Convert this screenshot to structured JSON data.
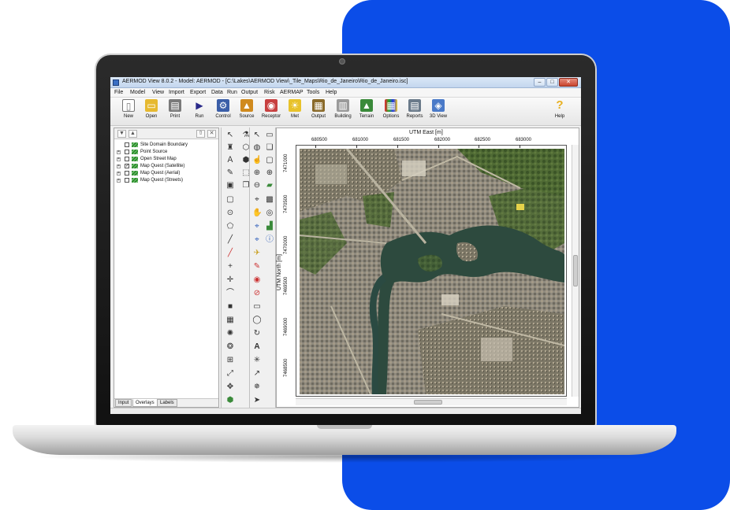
{
  "window": {
    "title": "AERMOD View 8.0.2 - Model: AERMOD  - [C:\\Lakes\\AERMOD View\\_Tile_Maps\\Rio_de_Janeiro\\Rio_de_Janeiro.isc]"
  },
  "menu": [
    "File",
    "Model",
    "View",
    "Import",
    "Export",
    "Data",
    "Run",
    "Output",
    "Risk",
    "AERMAP",
    "Tools",
    "Help"
  ],
  "toolbar": {
    "items": [
      {
        "label": "New",
        "icon": "new-file-icon",
        "color": "#ffffff"
      },
      {
        "label": "Open",
        "icon": "folder-icon",
        "color": "#e6b930"
      },
      {
        "label": "Print",
        "icon": "printer-icon",
        "color": "#7a7a7a"
      },
      {
        "label": "Run",
        "icon": "run-icon",
        "color": "#2a2a8a"
      },
      {
        "label": "Control",
        "icon": "control-icon",
        "color": "#3b5ea8"
      },
      {
        "label": "Source",
        "icon": "source-icon",
        "color": "#d08a1e"
      },
      {
        "label": "Receptor",
        "icon": "receptor-icon",
        "color": "#c84040"
      },
      {
        "label": "Met",
        "icon": "met-icon",
        "color": "#e8c22a"
      },
      {
        "label": "Output",
        "icon": "output-icon",
        "color": "#8a6a2a"
      },
      {
        "label": "Building",
        "icon": "building-icon",
        "color": "#9a9a9a"
      },
      {
        "label": "Terrain",
        "icon": "terrain-icon",
        "color": "#3a8a3a"
      },
      {
        "label": "Options",
        "icon": "options-icon",
        "color": "#b03aa0"
      },
      {
        "label": "Reports",
        "icon": "reports-icon",
        "color": "#6a7a8a"
      },
      {
        "label": "3D View",
        "icon": "3d-view-icon",
        "color": "#4a7ac8"
      },
      {
        "label": "Help",
        "icon": "help-icon",
        "color": "#e8b020"
      }
    ]
  },
  "tree": {
    "items": [
      {
        "label": "Site Domain Boundary",
        "checked": false,
        "expandable": false
      },
      {
        "label": "Point Source",
        "checked": false,
        "expandable": true
      },
      {
        "label": "Open Street Map",
        "checked": false,
        "expandable": true
      },
      {
        "label": "Map Quest (Satellite)",
        "checked": true,
        "expandable": true
      },
      {
        "label": "Map Quest (Aerial)",
        "checked": false,
        "expandable": true
      },
      {
        "label": "Map Quest (Streets)",
        "checked": false,
        "expandable": true
      }
    ],
    "checkmark": "✓",
    "plus": "+"
  },
  "tabs": [
    "Input",
    "Overlays",
    "Labels"
  ],
  "active_tab": "Overlays",
  "map": {
    "x_axis_title": "UTM East [m]",
    "y_axis_title": "UTM North [m]",
    "x_ticks": [
      "680500",
      "681000",
      "681500",
      "682000",
      "682500",
      "683000"
    ],
    "y_ticks": [
      "7471000",
      "7470500",
      "7470000",
      "7469500",
      "7469000",
      "7468500"
    ]
  },
  "colors": {
    "accent_panel": "#0b4de8",
    "water": "#2d4a3e",
    "urban": "#8f8a7e",
    "vegetation": "#4f6a34"
  }
}
